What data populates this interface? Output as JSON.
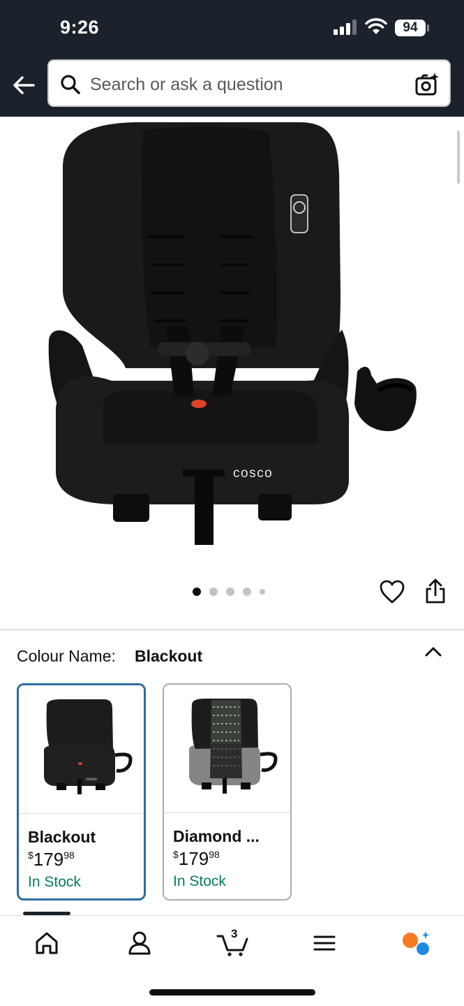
{
  "status_bar": {
    "time": "9:26",
    "battery": "94"
  },
  "header": {
    "search_placeholder": "Search or ask a question",
    "icons": [
      "back-arrow-icon",
      "search-icon",
      "camera-search-icon"
    ]
  },
  "product": {
    "image_brand_text": "cosco",
    "carousel": {
      "count": 5,
      "active_index": 0
    }
  },
  "variation": {
    "label": "Colour Name:",
    "value": "Blackout",
    "options": [
      {
        "name": "Blackout",
        "currency": "$",
        "whole": "179",
        "fraction": "98",
        "stock": "In Stock",
        "selected": true
      },
      {
        "name": "Diamond ...",
        "currency": "$",
        "whole": "179",
        "fraction": "98",
        "stock": "In Stock",
        "selected": false
      }
    ]
  },
  "bottom_nav": {
    "cart_count": "3",
    "items": [
      "home-icon",
      "account-icon",
      "cart-icon",
      "menu-icon",
      "rufus-icon"
    ]
  },
  "colors": {
    "header_bg": "#1b222c",
    "selected_border": "#2d6ca3",
    "in_stock_green": "#067d62",
    "rufus_orange": "#f47b20",
    "rufus_blue": "#1e88e5"
  }
}
